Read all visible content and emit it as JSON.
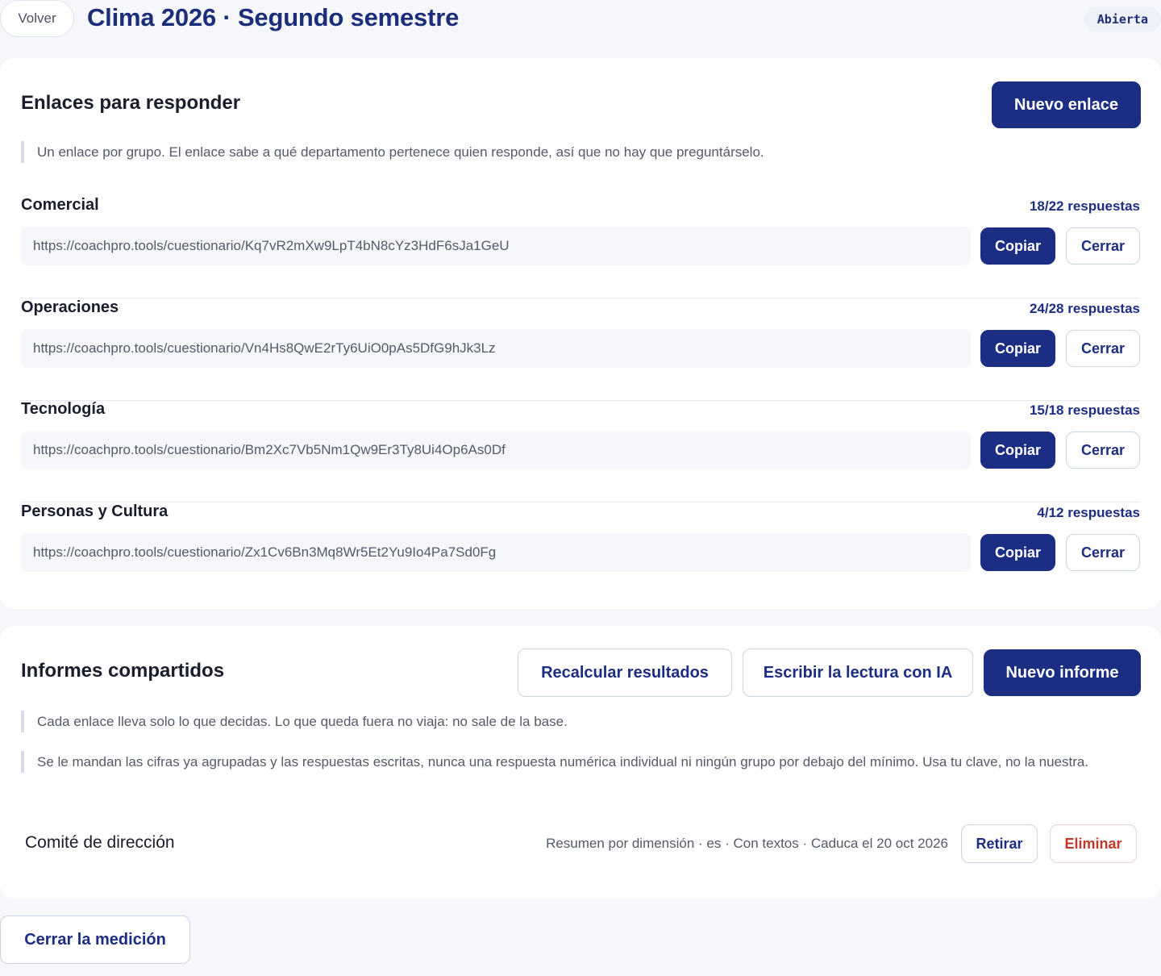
{
  "header": {
    "back_label": "Volver",
    "title": "Clima 2026 · Segundo semestre",
    "status": "Abierta"
  },
  "links": {
    "title": "Enlaces para responder",
    "new_button": "Nuevo enlace",
    "note": "Un enlace por grupo. El enlace sabe a qué departamento pertenece quien responde, así que no hay que preguntárselo.",
    "copy_label": "Copiar",
    "close_label": "Cerrar",
    "groups": [
      {
        "name": "Comercial",
        "count": "18/22 respuestas",
        "url": "https://coachpro.tools/cuestionario/Kq7vR2mXw9LpT4bN8cYz3HdF6sJa1GeU"
      },
      {
        "name": "Operaciones",
        "count": "24/28 respuestas",
        "url": "https://coachpro.tools/cuestionario/Vn4Hs8QwE2rTy6UiO0pAs5DfG9hJk3Lz"
      },
      {
        "name": "Tecnología",
        "count": "15/18 respuestas",
        "url": "https://coachpro.tools/cuestionario/Bm2Xc7Vb5Nm1Qw9Er3Ty8Ui4Op6As0Df"
      },
      {
        "name": "Personas y Cultura",
        "count": "4/12 respuestas",
        "url": "https://coachpro.tools/cuestionario/Zx1Cv6Bn3Mq8Wr5Et2Yu9Io4Pa7Sd0Fg"
      }
    ]
  },
  "reports": {
    "title": "Informes compartidos",
    "recalc_button": "Recalcular resultados",
    "ai_button": "Escribir la lectura con IA",
    "new_button": "Nuevo informe",
    "note_1": "Cada enlace lleva solo lo que decidas. Lo que queda fuera no viaja: no sale de la base.",
    "note_2": "Se le mandan las cifras ya agrupadas y las respuestas escritas, nunca una respuesta numérica individual ni ningún grupo por debajo del mínimo. Usa tu clave, no la nuestra.",
    "item": {
      "name": "Comité de dirección",
      "meta": "Resumen por dimensión · es · Con textos · Caduca el 20 oct 2026",
      "retire_label": "Retirar",
      "delete_label": "Eliminar"
    }
  },
  "footer": {
    "close_measurement_label": "Cerrar la medición"
  }
}
